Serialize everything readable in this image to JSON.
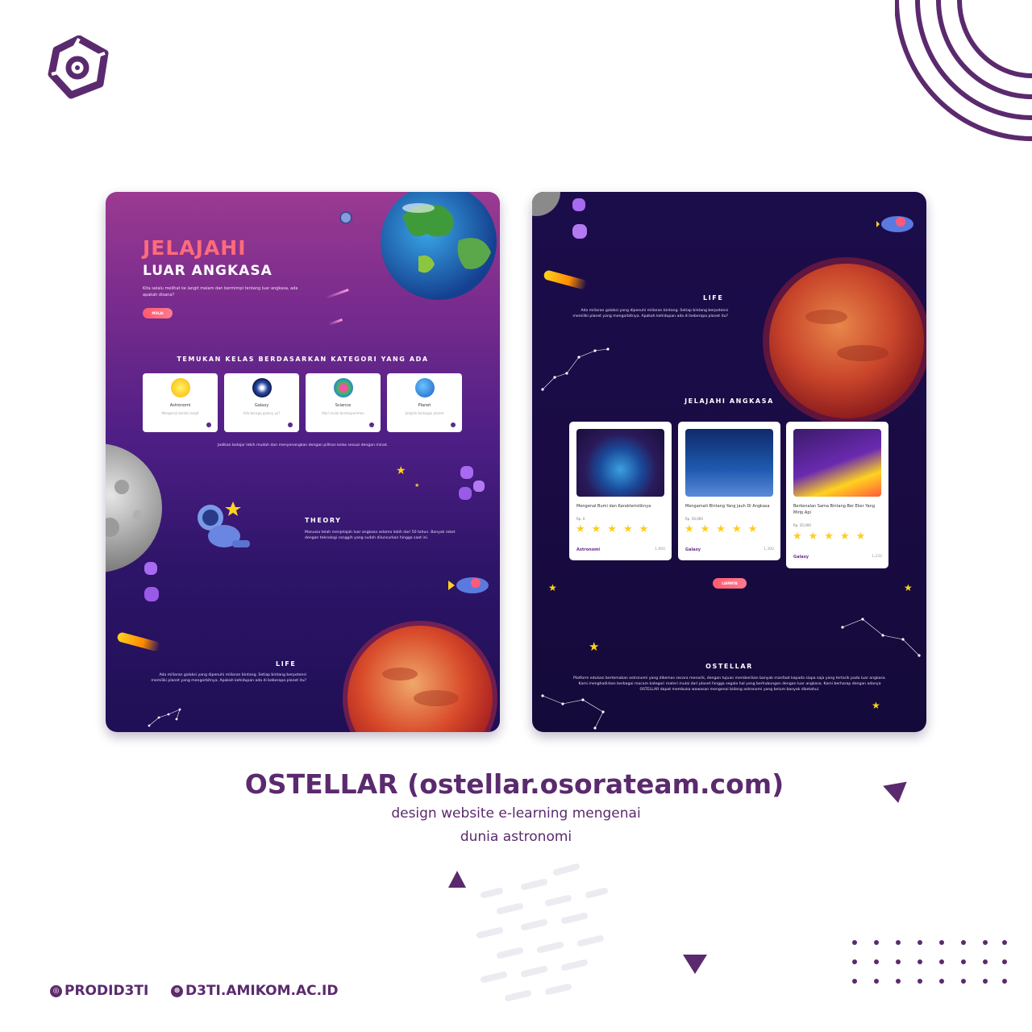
{
  "brand": {
    "accent": "#5b2a6e",
    "cta": "#ff5a6e"
  },
  "left_page": {
    "hero_title": "JELAJAHI",
    "hero_subtitle": "LUAR ANGKASA",
    "hero_desc": "Kita selalu melihat ke langit malam dan bermimpi tentang luar angkasa, ada apakah disana?",
    "hero_button": "MULAI",
    "category_heading": "TEMUKAN KELAS BERDASARKAN KATEGORI YANG ADA",
    "categories": [
      {
        "name": "Astronomi",
        "desc": "Mengenal benda langit",
        "icon": "sun-icon"
      },
      {
        "name": "Galaxy",
        "desc": "Ada berapa galaxy ya?",
        "icon": "galaxy-icon"
      },
      {
        "name": "Science",
        "desc": "Mari mulai bereksperimen",
        "icon": "atom-icon"
      },
      {
        "name": "Planet",
        "desc": "Jelajahi berbagai planet",
        "icon": "planet-icon"
      }
    ],
    "category_note": "Jadikan belajar lebih mudah dan menyenangkan dengan pilihan kelas sesuai dengan minat.",
    "theory_heading": "THEORY",
    "theory_text": "Manusia telah menjelajah luar angkasa selama lebih dari 50 tahun. Banyak roket dengan teknologi canggih yang sudah diluncurkan hingga saat ini.",
    "life_heading": "LIFE",
    "life_text": "Ada miliaran galaksi yang dipenuhi miliaran bintang. Setiap bintang berpotensi memiliki planet yang mengorbitnya. Apakah kehidupan ada di beberapa planet itu?"
  },
  "right_page": {
    "life_heading": "LIFE",
    "life_text": "Ada miliaran galaksi yang dipenuhi miliaran bintang. Setiap bintang berpotensi memiliki planet yang mengorbitnya. Apakah kehidupan ada di beberapa planet itu?",
    "courses_heading": "JELAJAHI ANGKASA",
    "courses": [
      {
        "title": "Mengenal Bumi dan Karakteristiknya",
        "price": "Rp. 0",
        "category": "Astronomi",
        "views": "1,900",
        "rating": 5
      },
      {
        "title": "Mengamati Bintang Yang Jauh Di Angkasa",
        "price": "Rp. 50,000",
        "category": "Galaxy",
        "views": "1,300",
        "rating": 5
      },
      {
        "title": "Berkenalan Sama Bintang Ber Ekor Yang Mirip Api",
        "price": "Rp. 35,000",
        "category": "Galaxy",
        "views": "1,232",
        "rating": 5
      }
    ],
    "more_button": "LAINNYA",
    "about_heading": "OSTELLAR",
    "about_text": "Platform edukasi bertemakan astronomi yang dikemas secara menarik, dengan tujuan memberikan banyak manfaat kepada siapa saja yang tertarik pada luar angkasa. Kami menghadirkan berbagai macam kategori materi mulai dari planet hingga segala hal yang berhubungan dengan luar angkasa. Kami berharap dengan adanya OSTELLAR dapat membuka wawasan mengenai bidang astronomi yang belum banyak diketahui."
  },
  "caption": {
    "title": "OSTELLAR  (ostellar.osorateam.com)",
    "line1": "design website e-learning mengenai",
    "line2": "dunia astronomi"
  },
  "footer": {
    "instagram": "PRODID3TI",
    "website": "D3TI.AMIKOM.AC.ID"
  }
}
